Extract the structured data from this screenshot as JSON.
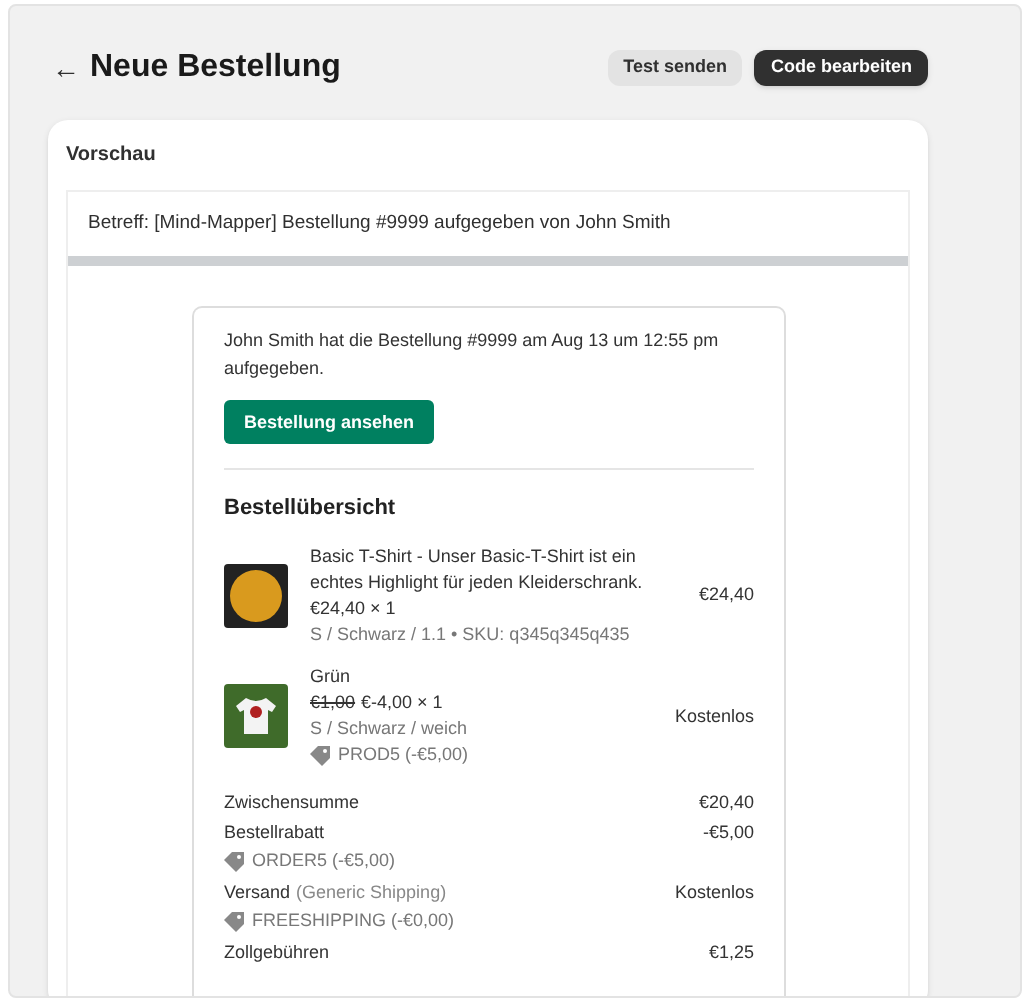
{
  "header": {
    "back": "←",
    "title": "Neue Bestellung",
    "buttons": [
      {
        "label": "Test senden",
        "kind": "secondary"
      },
      {
        "label": "Code bearbeiten",
        "kind": "primary"
      }
    ]
  },
  "preview": {
    "title": "Vorschau",
    "subject": "Betreff: [Mind-Mapper] Bestellung #9999 aufgegeben von John Smith",
    "email": {
      "intro": "John Smith hat die Bestellung #9999 am Aug 13 um 12:55 pm aufgegeben.",
      "button": "Bestellung ansehen",
      "summary_title": "Bestellübersicht",
      "items": [
        {
          "title": "Basic T-Shirt - Unser Basic-T-Shirt ist ein echtes Highlight für jeden Kleiderschrank.",
          "price": "€24,40 × 1",
          "variant": "S / Schwarz / 1.1 • SKU: q345q345q435",
          "total": "€24,40"
        },
        {
          "title": "Grün",
          "original_price": "€1,00",
          "price": "€-4,00 × 1",
          "variant": "S / Schwarz / weich",
          "discount": "PROD5 (-€5,00)",
          "total": "Kostenlos"
        }
      ],
      "totals": [
        {
          "label": "Zwischensumme",
          "value": "€20,40"
        },
        {
          "label": "Bestellrabatt",
          "value": "-€5,00",
          "discount": "ORDER5 (-€5,00)"
        },
        {
          "label": "Versand",
          "note": "(Generic Shipping)",
          "value": "Kostenlos",
          "discount": "FREESHIPPING (-€0,00)"
        },
        {
          "label": "Zollgebühren",
          "value": "€1,25"
        }
      ]
    }
  }
}
